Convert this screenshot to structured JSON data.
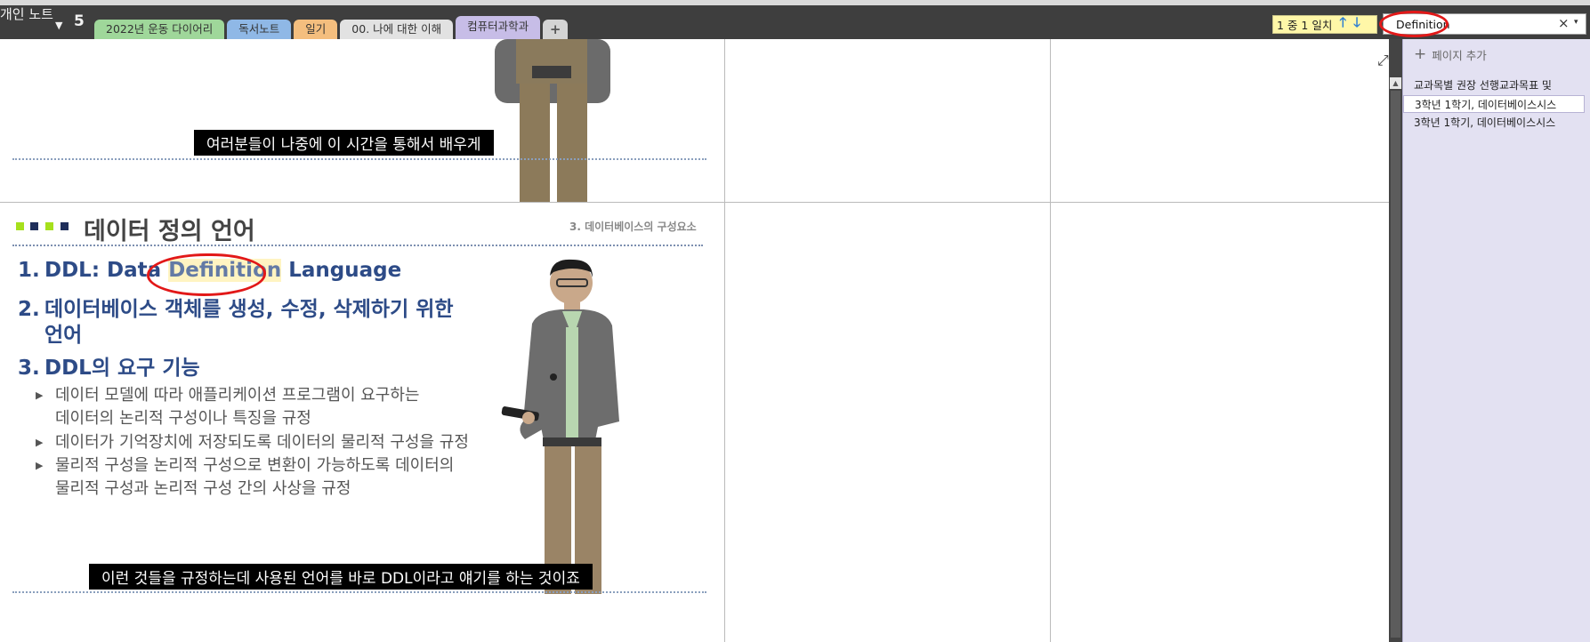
{
  "app": {
    "notebook_title": "개인 노트",
    "notebook_number": "5"
  },
  "section_tabs": [
    {
      "label": "2022년 운동 다이어리",
      "color": "#9fd79a"
    },
    {
      "label": "독서노트",
      "color": "#8fb8e6"
    },
    {
      "label": "일기",
      "color": "#f4be7e"
    },
    {
      "label": "00. 나에 대한 이해",
      "color": "#e2e2e2"
    },
    {
      "label": "컴퓨터과학과",
      "color": "#c7bde7",
      "active": true
    }
  ],
  "add_tab_label": "+",
  "search": {
    "match_status": "1 중 1 일치",
    "up_arrow": "🡑",
    "down_arrow": "🡓",
    "query": "Definition",
    "clear": "×",
    "dropdown": "▾"
  },
  "slide1": {
    "subtitle": "여러분들이 나중에 이 시간을 통해서 배우게"
  },
  "slide2": {
    "title": "데이터 정의 언어",
    "section_label": "3. 데이터베이스의 구성요소",
    "items": [
      {
        "num": "1.",
        "prefix": "DDL: Data ",
        "highlight": "Definition",
        "suffix": " Language"
      },
      {
        "num": "2.",
        "line1": "데이터베이스 객체를 생성, 수정, 삭제하기 위한",
        "line2": "언어"
      },
      {
        "num": "3.",
        "text": "DDL의 요구 기능"
      }
    ],
    "bullets": [
      {
        "line1": "데이터 모델에 따라 애플리케이션 프로그램이 요구하는",
        "line2": "데이터의 논리적 구성이나 특징을 규정"
      },
      {
        "line1": "데이터가 기억장치에 저장되도록 데이터의 물리적 구성을 규정"
      },
      {
        "line1": "물리적 구성을 논리적 구성으로 변환이 가능하도록 데이터의",
        "line2": "물리적 구성과 논리적 구성 간의 사상을 규정"
      }
    ],
    "bullet_marker": "▶",
    "subtitle": "이런 것들을 규정하는데 사용된 언어를 바로 DDL이라고 얘기를 하는 것이죠"
  },
  "page_panel": {
    "add_page_label": "페이지 추가",
    "add_page_icon": "+",
    "pages": [
      {
        "title": "교과목별 권장 선행교과목표 및",
        "selected": false
      },
      {
        "title": "3학년 1학기, 데이터베이스시스",
        "selected": true
      },
      {
        "title": "3학년 1학기, 데이터베이스시스",
        "selected": false
      }
    ]
  },
  "icons": {
    "dropdown": "chevron-down-icon",
    "expand": "expand-icon",
    "scroll_up": "▲",
    "expand_glyph": "⤢"
  },
  "colors": {
    "accent_green": "#a6e01c",
    "slide_blue": "#2d4b87",
    "annotation_red": "#e21818",
    "match_yellow": "#fff7a8"
  }
}
